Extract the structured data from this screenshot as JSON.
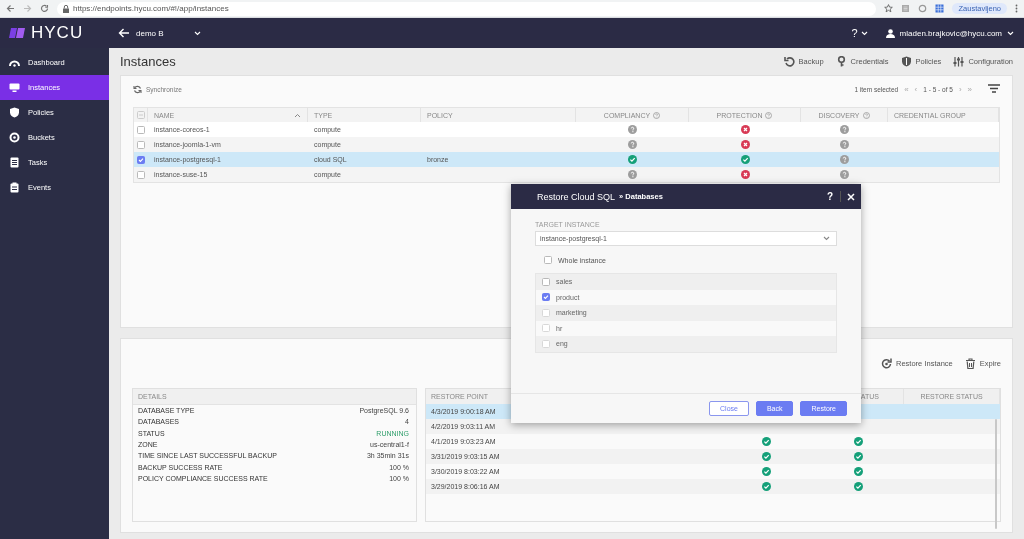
{
  "browser": {
    "url": "https://endpoints.hycu.com/#!/app/instances",
    "profile": "Zaustavljeno"
  },
  "app": {
    "logo": "HYCU",
    "project": "demo B",
    "help": "?",
    "user": "mladen.brajkovic@hycu.com"
  },
  "sidebar": {
    "items": [
      {
        "label": "Dashboard",
        "selected": false
      },
      {
        "label": "Instances",
        "selected": true
      },
      {
        "label": "Policies",
        "selected": false
      },
      {
        "label": "Buckets",
        "selected": false
      },
      {
        "label": "Tasks",
        "selected": false
      },
      {
        "label": "Events",
        "selected": false
      }
    ]
  },
  "page": {
    "title": "Instances",
    "actions": [
      {
        "label": "Backup"
      },
      {
        "label": "Credentials"
      },
      {
        "label": "Policies"
      },
      {
        "label": "Configuration"
      }
    ]
  },
  "instances": {
    "synchronize": "Synchronize",
    "selection_count": "1 item selected",
    "pagination": {
      "first": "«",
      "prev": "‹",
      "range": "1 - 5 - of 5",
      "next": "›",
      "last": "»"
    },
    "columns": [
      {
        "label": "NAME",
        "help": false,
        "sorted": true
      },
      {
        "label": "TYPE",
        "help": false,
        "sorted": false
      },
      {
        "label": "POLICY",
        "help": false,
        "sorted": false
      },
      {
        "label": "COMPLIANCY",
        "help": true,
        "sorted": false
      },
      {
        "label": "PROTECTION",
        "help": true,
        "sorted": false
      },
      {
        "label": "DISCOVERY",
        "help": true,
        "sorted": false
      },
      {
        "label": "CREDENTIAL GROUP",
        "help": false,
        "sorted": false
      }
    ],
    "rows": [
      {
        "name": "instance-coreos-1",
        "type": "compute",
        "compliancy": {
          "kind": "unknown"
        },
        "protection": {
          "kind": "error"
        },
        "discovery": {
          "kind": "unknown"
        },
        "selected": false
      },
      {
        "name": "instance-joomla-1-vm",
        "type": "compute",
        "compliancy": {
          "kind": "unknown"
        },
        "protection": {
          "kind": "error"
        },
        "discovery": {
          "kind": "unknown"
        },
        "selected": false
      },
      {
        "name": "instance-postgresql-1",
        "type": "cloud SQL",
        "policy": "bronze",
        "compliancy": {
          "kind": "ok"
        },
        "protection": {
          "kind": "ok"
        },
        "discovery": {
          "kind": "unknown"
        },
        "selected": true
      },
      {
        "name": "instance-suse-15",
        "type": "compute",
        "compliancy": {
          "kind": "unknown"
        },
        "protection": {
          "kind": "error"
        },
        "discovery": {
          "kind": "unknown"
        },
        "selected": false
      }
    ]
  },
  "details": {
    "title": "DETAILS",
    "fields": [
      {
        "label": "DATABASE TYPE",
        "value": "PostgreSQL 9.6",
        "kind": "plain"
      },
      {
        "label": "DATABASES",
        "value": "4",
        "kind": "plain"
      },
      {
        "label": "STATUS",
        "value": "RUNNING",
        "kind": "status"
      },
      {
        "label": "ZONE",
        "value": "us-central1-f",
        "kind": "plain"
      },
      {
        "label": "TIME SINCE LAST SUCCESSFUL BACKUP",
        "value": "3h 35min 31s",
        "kind": "plain"
      },
      {
        "label": "BACKUP SUCCESS RATE",
        "value": "100 %",
        "kind": "plain"
      },
      {
        "label": "POLICY COMPLIANCE SUCCESS RATE",
        "value": "100 %",
        "kind": "plain"
      }
    ]
  },
  "restore_points": {
    "actions": [
      {
        "label": "Restore Instance"
      },
      {
        "label": "Expire"
      }
    ],
    "columns": {
      "restore_point": "RESTORE POINT",
      "column_3": "ATUS",
      "restore_status": "RESTORE STATUS"
    },
    "rows": [
      {
        "time": "4/3/2019 9:00:18 AM",
        "selected": true
      },
      {
        "time": "4/2/2019 9:03:11 AM",
        "selected": false
      },
      {
        "time": "4/1/2019 9:03:23 AM",
        "column_2": {
          "kind": "ok"
        },
        "column_3": {
          "kind": "ok"
        },
        "selected": false
      },
      {
        "time": "3/31/2019 9:03:15 AM",
        "column_2": {
          "kind": "ok"
        },
        "column_3": {
          "kind": "ok"
        },
        "selected": false
      },
      {
        "time": "3/30/2019 8:03:22 AM",
        "column_2": {
          "kind": "ok"
        },
        "column_3": {
          "kind": "ok"
        },
        "selected": false
      },
      {
        "time": "3/29/2019 8:06:16 AM",
        "column_2": {
          "kind": "ok"
        },
        "column_3": {
          "kind": "ok"
        },
        "selected": false
      }
    ]
  },
  "dialog": {
    "title": "Restore Cloud SQL",
    "subtitle": "» Databases",
    "help": "?",
    "target_label": "TARGET INSTANCE",
    "target_value": "instance-postgresql-1",
    "whole_instance": {
      "label": "Whole instance",
      "checked": false
    },
    "databases": [
      {
        "label": "sales",
        "checked": false
      },
      {
        "label": "product",
        "checked": true
      },
      {
        "label": "marketing",
        "checked": false
      },
      {
        "label": "hr",
        "checked": false
      },
      {
        "label": "eng",
        "checked": false
      }
    ],
    "buttons": [
      {
        "label": "Close",
        "kind": "secondary"
      },
      {
        "label": "Back",
        "kind": "primary"
      },
      {
        "label": "Restore",
        "kind": "primary"
      }
    ]
  }
}
